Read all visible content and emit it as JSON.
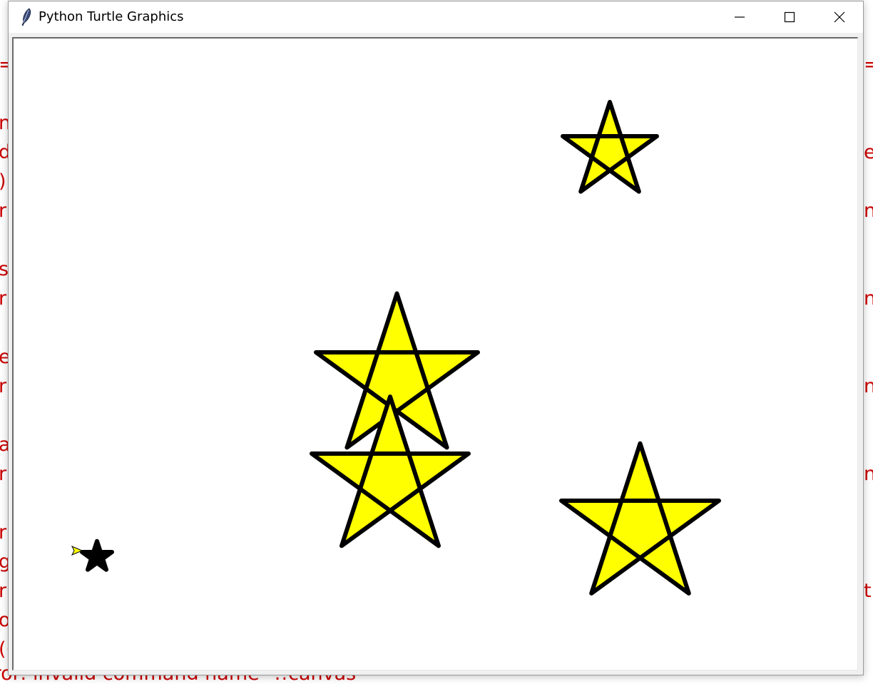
{
  "window": {
    "title": "Python Turtle Graphics",
    "controls": [
      "minimize",
      "maximize",
      "close"
    ]
  },
  "background_console": {
    "left_fragments": [
      "=",
      "n",
      "d",
      ")",
      "r",
      "s",
      "r",
      "e",
      "r",
      "a",
      "r",
      "r",
      "g",
      "r",
      "o",
      "(("
    ],
    "right_fragments": [
      "=",
      "e",
      "n",
      "n",
      "n",
      "n",
      "t"
    ],
    "bottom_fragment": "rror: invalid command name \".!canvas",
    "text_color": "#cc0000"
  },
  "canvas": {
    "background": "#ffffff",
    "star_fill": "#ffff00",
    "star_outline": "#000000",
    "turtle_fill": "#ffff00",
    "turtle_star_fill": "#000000"
  }
}
